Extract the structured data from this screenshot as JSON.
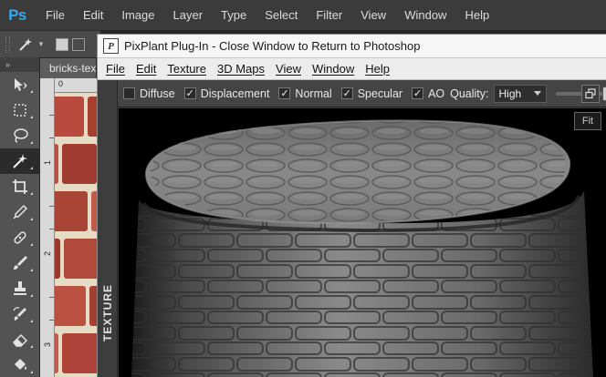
{
  "photoshop": {
    "logo": "Ps",
    "menu": [
      "File",
      "Edit",
      "Image",
      "Layer",
      "Type",
      "Select",
      "Filter",
      "View",
      "Window",
      "Help"
    ],
    "doc_tab": "bricks-tex",
    "ruler_v_labels": [
      "1",
      "2",
      "3"
    ],
    "ruler_h_label": "0"
  },
  "pixplant": {
    "logo": "P",
    "title": "PixPlant Plug-In - Close Window to Return to Photoshop",
    "menu": [
      "File",
      "Edit",
      "Texture",
      "3D Maps",
      "View",
      "Window",
      "Help"
    ],
    "toolbar": {
      "diffuse": {
        "label": "Diffuse",
        "checked": false
      },
      "displacement": {
        "label": "Displacement",
        "checked": true
      },
      "normal": {
        "label": "Normal",
        "checked": true
      },
      "specular": {
        "label": "Specular",
        "checked": true
      },
      "ao": {
        "label": "AO",
        "checked": true
      },
      "quality_label": "Quality:",
      "quality_value": "High",
      "slider_level": 1.0
    },
    "viewport": {
      "fit_label": "Fit"
    },
    "side_tab": "TEXTURE",
    "check_glyph": "✓"
  },
  "colors": {
    "ps_blue": "#34a8f2",
    "ps_bg": "#282828",
    "brick": "#b0443a"
  }
}
